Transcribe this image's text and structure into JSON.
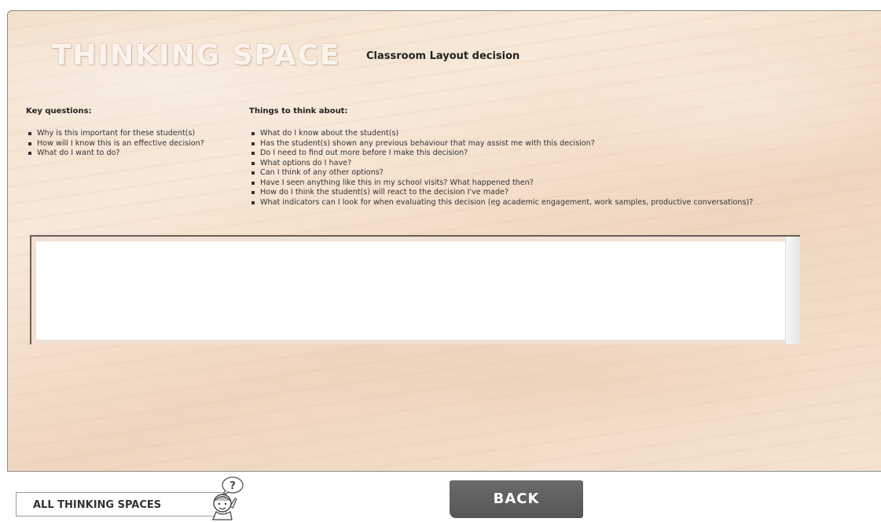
{
  "header": {
    "title": "THINKING SPACE",
    "subtitle": "Classroom Layout decision"
  },
  "key_questions": {
    "heading": "Key questions:",
    "items": [
      "Why is this important for these student(s)",
      "How will I know this is an effective decision?",
      "What do I want to do?"
    ]
  },
  "things_to_think": {
    "heading": "Things to think about:",
    "items": [
      "What do I know about the student(s)",
      "Has the student(s) shown any previous behaviour that may assist me with this decision?",
      "Do I need to find out more before I make this decision?",
      "What options do I have?",
      "Can I think of any other options?",
      "Have I seen anything like this in my school visits? What happened then?",
      "How do I think the student(s) will react to the decision I've made?",
      "What indicators can I look for when evaluating this decision (eg academic engagement, work samples, productive conversations)?"
    ]
  },
  "notes": {
    "value": ""
  },
  "footer": {
    "all_spaces_label": "ALL THINKING SPACES",
    "help_icon": "character-question-icon",
    "help_symbol": "?",
    "back_label": "BACK"
  },
  "colors": {
    "board_wood": "#f3e1ce",
    "back_button": "#5f5f5f",
    "title_text": "#fbf4ee"
  }
}
